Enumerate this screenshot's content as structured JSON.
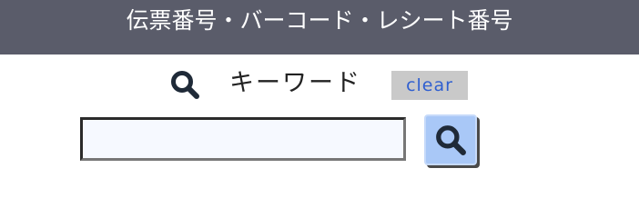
{
  "header": {
    "title": "伝票番号・バーコード・レシート番号"
  },
  "keyword": {
    "icon": "search-icon",
    "label": "キーワード",
    "clear_label": "clear"
  },
  "search": {
    "value": "",
    "placeholder": "",
    "button_icon": "search-icon"
  },
  "colors": {
    "header_bg": "#5a5c6a",
    "clear_bg": "#c9c9c9",
    "clear_text": "#2f5fd0",
    "search_button_bg": "#a9c8f7"
  }
}
